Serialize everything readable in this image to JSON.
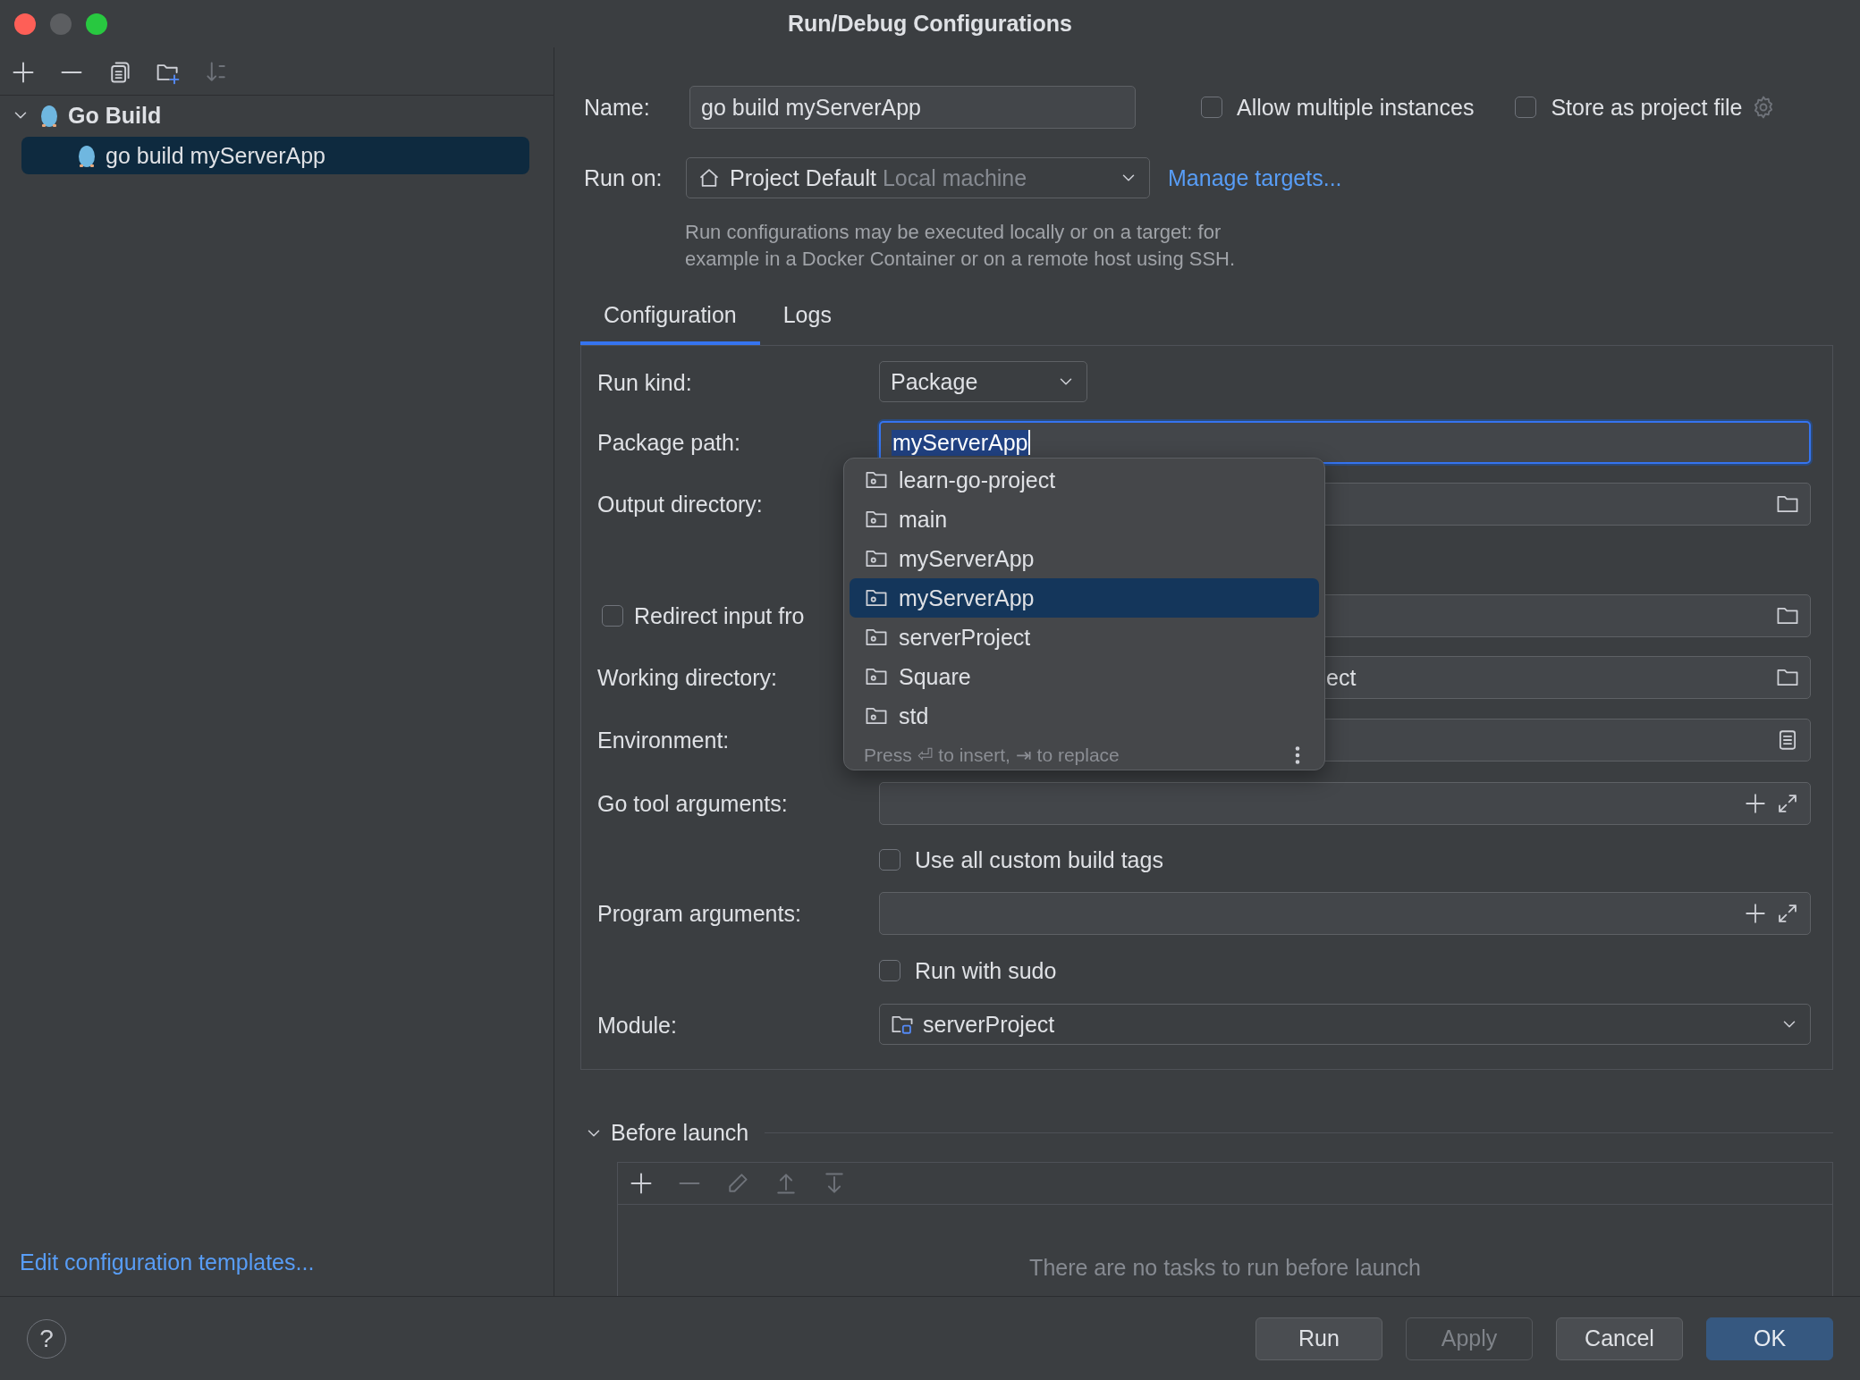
{
  "window": {
    "title": "Run/Debug Configurations"
  },
  "sidebar": {
    "toolbar": [
      {
        "kind": "add",
        "disabled": false
      },
      {
        "kind": "remove",
        "disabled": false
      },
      {
        "kind": "copy",
        "disabled": false
      },
      {
        "kind": "new-folder",
        "disabled": false
      },
      {
        "kind": "sort",
        "disabled": true
      }
    ],
    "tree": [
      {
        "label": "Go Build",
        "expanded": true,
        "selected": false,
        "children": [
          {
            "label": "go build myServerApp",
            "selected": true
          }
        ]
      }
    ],
    "footer_link": "Edit configuration templates..."
  },
  "header": {
    "name": {
      "label": "Name:",
      "value": "go build myServerApp"
    },
    "options": [
      {
        "label": "Allow multiple instances",
        "checked": false
      },
      {
        "label": "Store as project file",
        "checked": false
      }
    ],
    "run_on": {
      "label": "Run on:",
      "value": "Project Default",
      "hint": "Local machine"
    },
    "manage_link": "Manage targets...",
    "description": "Run configurations may be executed locally or on a target: for example in a Docker Container or on a remote host using SSH."
  },
  "tabs": [
    {
      "label": "Configuration",
      "selected": true
    },
    {
      "label": "Logs",
      "selected": false
    }
  ],
  "config_rows": [
    {
      "kind": "dropdown",
      "label": "Run kind:",
      "value": "Package"
    },
    {
      "kind": "text",
      "label": "Package path:",
      "value": "myServerApp",
      "focused": true
    },
    {
      "kind": "folder",
      "label": "Output directory:"
    },
    {
      "kind": "checkbox-folder",
      "label": "Redirect input fro",
      "checked": false
    },
    {
      "kind": "folder",
      "label": "Working directory:",
      "value": "ect"
    },
    {
      "kind": "list",
      "label": "Environment:"
    },
    {
      "kind": "expand",
      "label": "Go tool arguments:"
    },
    {
      "kind": "checkbox",
      "label": "Use all custom build tags",
      "checked": false
    },
    {
      "kind": "expand",
      "label": "Program arguments:"
    },
    {
      "kind": "checkbox",
      "label": "Run with sudo",
      "checked": false
    },
    {
      "kind": "module",
      "label": "Module:",
      "value": "serverProject"
    }
  ],
  "completion": {
    "items": [
      {
        "label": "learn-go-project",
        "selected": false
      },
      {
        "label": "main",
        "selected": false
      },
      {
        "label": "myServerApp",
        "selected": false
      },
      {
        "label": "myServerApp",
        "selected": true
      },
      {
        "label": "serverProject",
        "selected": false
      },
      {
        "label": "Square",
        "selected": false
      },
      {
        "label": "std",
        "selected": false
      }
    ],
    "footer": "Press ⏎ to insert, ⇥ to replace"
  },
  "before_launch": {
    "label": "Before launch",
    "expanded": true,
    "tools": [
      {
        "kind": "add",
        "disabled": false
      },
      {
        "kind": "remove",
        "disabled": true
      },
      {
        "kind": "edit",
        "disabled": true
      },
      {
        "kind": "up",
        "disabled": true
      },
      {
        "kind": "down",
        "disabled": true
      }
    ],
    "empty_text": "There are no tasks to run before launch"
  },
  "help": "?",
  "buttons": [
    {
      "label": "Run",
      "disabled": false,
      "default": false
    },
    {
      "label": "Apply",
      "disabled": true,
      "default": false
    },
    {
      "label": "Cancel",
      "disabled": false,
      "default": false
    },
    {
      "label": "OK",
      "disabled": false,
      "default": true
    }
  ]
}
